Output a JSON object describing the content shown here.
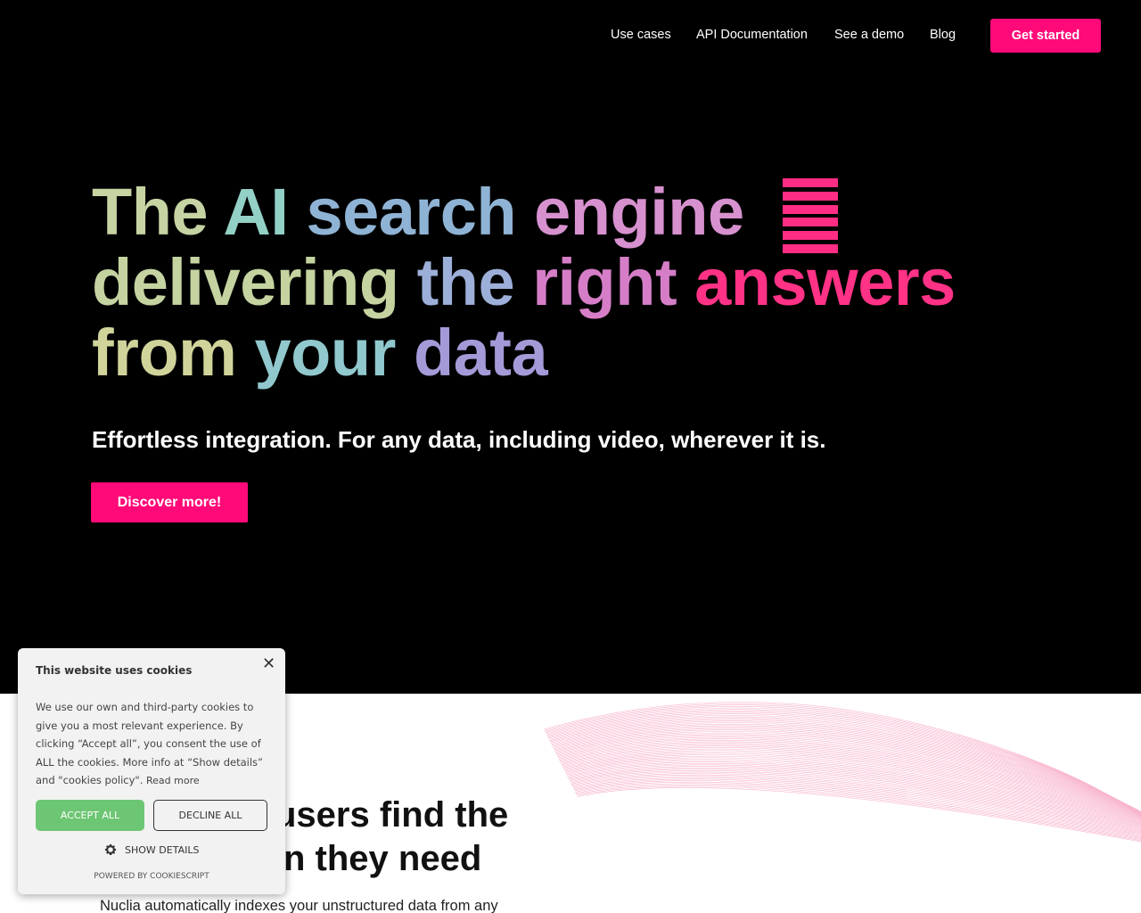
{
  "nav": {
    "links": [
      "Use cases",
      "API Documentation",
      "See a demo",
      "Blog"
    ],
    "cta": "Get started"
  },
  "hero": {
    "headline": {
      "line1": [
        "The",
        "AI",
        "search",
        "engine"
      ],
      "line2": [
        "delivering",
        "the",
        "right",
        "answers"
      ],
      "line3": [
        "from",
        "your",
        "data"
      ]
    },
    "subtitle": "Effortless integration. For any data, including video, wherever it is.",
    "cta": "Discover more!"
  },
  "section": {
    "title_line1": "users find the",
    "title_line2": "n they need",
    "text": "Nuclia automatically indexes your unstructured data from any"
  },
  "cookie": {
    "title": "This website uses cookies",
    "close": "✕",
    "body": "We use our own and third-party cookies to give you a most relevant experience. By clicking “Accept all”, you consent the use of ALL the cookies. More info at “Show details” and \"cookies policy\".",
    "read_more": "Read more",
    "accept": "ACCEPT ALL",
    "decline": "DECLINE ALL",
    "show_details": "SHOW DETAILS",
    "powered": "POWERED BY COOKIESCRIPT"
  },
  "icons": {
    "menu_bars": "bars-icon",
    "settings": "gear-icon",
    "close": "close-icon"
  },
  "colors": {
    "brand_pink": "#ff0a78",
    "hero_bg": "#000000",
    "accept_green": "#6dc673"
  }
}
